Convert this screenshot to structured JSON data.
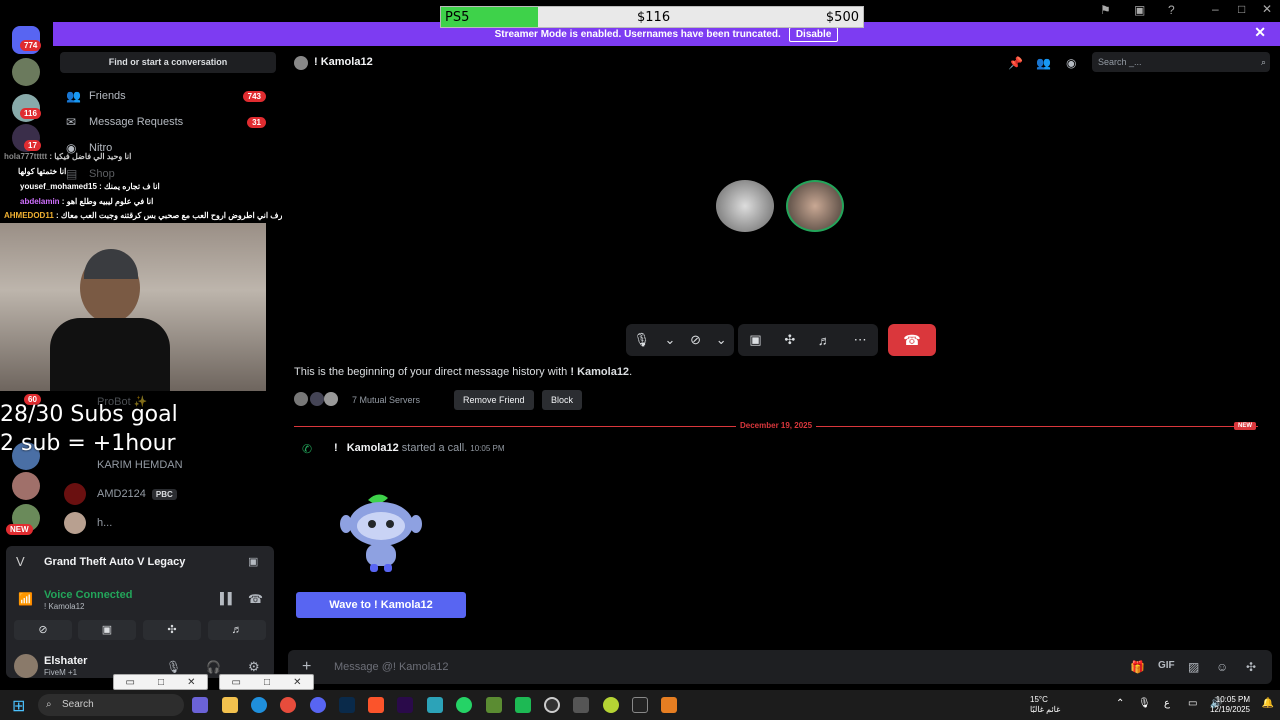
{
  "goal_bar": {
    "left_label": "PS5",
    "current": "$116",
    "target": "$500",
    "progress": 0.23
  },
  "streamer_banner": {
    "text": "Streamer Mode is enabled. Usernames have been truncated.",
    "disable_label": "Disable",
    "close": "✕"
  },
  "server_rail": {
    "badges": [
      "774",
      "116",
      "17",
      "60"
    ],
    "new_label": "NEW"
  },
  "sidebar": {
    "find_placeholder": "Find or start a conversation",
    "nav": [
      {
        "label": "Friends",
        "count": "743"
      },
      {
        "label": "Message Requests",
        "count": "31"
      },
      {
        "label": "Nitro",
        "count": ""
      },
      {
        "label": "Shop",
        "count": ""
      }
    ],
    "dms": [
      {
        "name": "ProBot ✨"
      },
      {
        "name": "KARIM HEMDAN"
      },
      {
        "name": "AMD2124"
      },
      {
        "name": "h..."
      }
    ],
    "pbc_tag": "PBC"
  },
  "stream_chat": [
    {
      "user": "hola777ttttt",
      "text": "انا وحيد الي فاضل فيكيا"
    },
    {
      "user": "",
      "text": "انا ختمتها كولها"
    },
    {
      "user": "yousef_mohamed15",
      "text": "انا ف تجاره يمنك"
    },
    {
      "user": "abdelamin",
      "text": "انا في علوم ليبيه وطلع اهو"
    },
    {
      "user": "AHMEDOD11",
      "text": "طب يا سطا تعرف اني اطروض اروح العب مع صحبي بس كرقتنه وجبت العب معاك"
    }
  ],
  "subs_goal": {
    "line1": "28/30 Subs goal",
    "line2": "2 sub = +1hour"
  },
  "activity": {
    "game": "Grand Theft Auto V Legacy",
    "voice_status": "Voice Connected",
    "voice_channel": "! Kamola12",
    "username": "Elshater",
    "user_status": "FiveM +1"
  },
  "header": {
    "dm_name": "! Kamola12",
    "search_placeholder": "Search _..."
  },
  "history": {
    "begin_prefix": "This is the beginning of your direct message history with ",
    "begin_name": "! Kamola12",
    "mutual_servers": "7 Mutual Servers",
    "remove_friend": "Remove Friend",
    "block": "Block",
    "date": "December 19, 2025",
    "new_tag": "NEW",
    "call_user": "Kamola12",
    "call_text": "started a call.",
    "call_time": "10:05 PM",
    "wave_label": "Wave to ! Kamola12"
  },
  "composer": {
    "placeholder": "Message @! Kamola12"
  },
  "taskbar": {
    "search": "Search",
    "weather_temp": "15°C",
    "weather_desc": "غائم غالبًا",
    "lang": "ع",
    "time": "10:05 PM",
    "date": "12/19/2025"
  },
  "colors": {
    "accent": "#5865f2",
    "danger": "#da373c",
    "streamer": "#7d3cf2",
    "online": "#23a55a"
  }
}
